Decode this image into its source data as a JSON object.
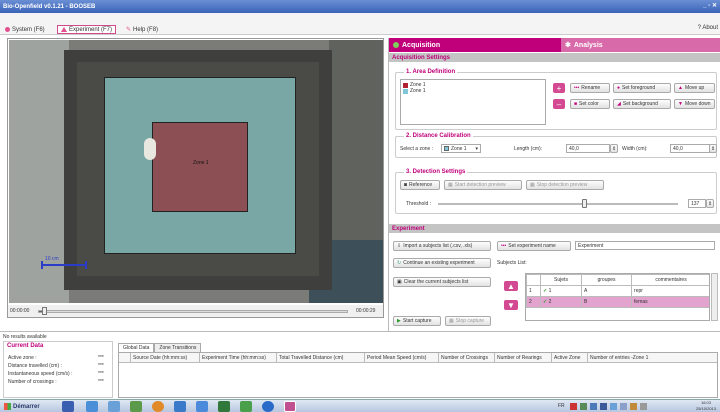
{
  "window": {
    "title": "Bio-Openfield v0.1.21 - BOOSEB",
    "controls": "_ ▫ ✕"
  },
  "menu": {
    "items": [
      {
        "label": "System (F6)",
        "color": "#e2508f"
      },
      {
        "label": "Experiment (F7)",
        "color": "#e2508f"
      },
      {
        "label": "Help (F8)",
        "color": "#e2508f"
      }
    ],
    "about": "? About"
  },
  "video": {
    "zone_label": "Zone 1",
    "scale_label": "10 cm",
    "time_start": "00:00:00",
    "time_end": "00:00:29",
    "progress": 0.02
  },
  "tabs": {
    "acquisition": "Acquisition",
    "analysis": "Analysis"
  },
  "acq": {
    "header": "Acquisition Settings",
    "area": {
      "title": "1. Area Definition",
      "zones": [
        {
          "name": "Zone 1",
          "color": "#b22233"
        },
        {
          "name": "Zone 1",
          "color": "#7fc7d8"
        }
      ],
      "buttons": {
        "rename": "Rename",
        "set_foreground": "Set foreground",
        "move_up": "Move up",
        "set_color": "Set color",
        "set_background": "Set background",
        "move_down": "Move down"
      }
    },
    "distance": {
      "title": "2. Distance Calibration",
      "select_zone_label": "Select a zone :",
      "zone_value": "Zone 1",
      "length_label": "Length (cm):",
      "length_value": "40,0",
      "width_label": "Width (cm):",
      "width_value": "40,0"
    },
    "detection": {
      "title": "3. Detection Settings",
      "reference": "Reference",
      "start_preview": "Start detection preview",
      "stop_preview": "Stop detection preview",
      "threshold_label": "Threshold :",
      "threshold_value": "137",
      "threshold_level": 0.61
    }
  },
  "experiment": {
    "header": "Experiment",
    "import_button": "Import a subjects list (.csv, .xls)",
    "set_name_button": "Set experiment name",
    "name_value": "Experiment",
    "continue_button": "Continue an existing experiment",
    "clear_button": "Clear the current subjects list",
    "subjects_label": "Subjects List:",
    "columns": [
      "Sujets",
      "groupes",
      "commentaires"
    ],
    "rows": [
      {
        "num": "1",
        "subject": "1",
        "group": "A",
        "comment": "repr"
      },
      {
        "num": "2",
        "subject": "2",
        "group": "B",
        "comment": "femas"
      }
    ],
    "start_capture": "Start capture",
    "stop_capture": "Stop capture"
  },
  "results": {
    "status": "No results available",
    "current_title": "Current Data",
    "current": [
      {
        "label": "Active zone :",
        "value": "***"
      },
      {
        "label": "Distance travelled (cm) :",
        "value": "***"
      },
      {
        "label": "Instantaneous speed (cm/s) :",
        "value": "***"
      },
      {
        "label": "Number of crossings :",
        "value": "***"
      }
    ],
    "tabs": [
      "Global Data",
      "Zone Transitions"
    ],
    "columns": [
      "Source Date (hh:mm:ss)",
      "Experiment Time (hh:mm:ss)",
      "Total Travelled Distance (cm)",
      "Period Mean Speed (cm/s)",
      "Number of Crossings",
      "Number of Rearings",
      "Active Zone",
      "Number of entries -Zone 1"
    ]
  },
  "taskbar": {
    "start": "Démarrer",
    "tray": "FR",
    "clock_time": "16:03",
    "clock_date": "25/10/2013"
  }
}
